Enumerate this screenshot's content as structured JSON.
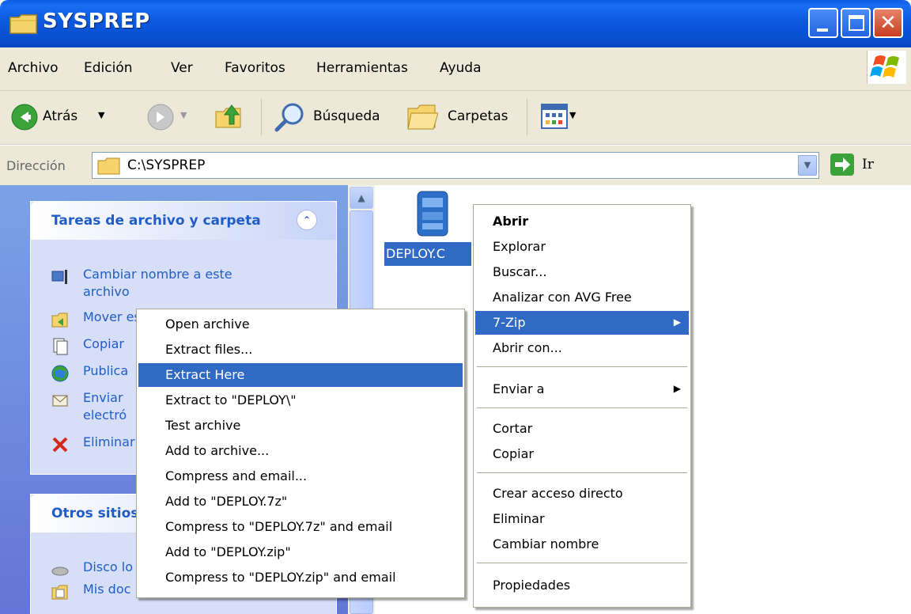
{
  "window": {
    "title": "SYSPREP"
  },
  "menubar": {
    "items": [
      "Archivo",
      "Edición",
      "Ver",
      "Favoritos",
      "Herramientas",
      "Ayuda"
    ]
  },
  "toolbar": {
    "back_label": "Atrás",
    "search_label": "Búsqueda",
    "folders_label": "Carpetas"
  },
  "address": {
    "label": "Dirección",
    "value": "C:\\SYSPREP",
    "go_label": "Ir"
  },
  "tasks": {
    "panel_title": "Tareas de archivo y carpeta",
    "items": [
      "Cambiar nombre a este",
      "archivo",
      "Mover este archivo",
      "Copiar",
      "Publica",
      "Enviar",
      "electró",
      "Eliminar"
    ]
  },
  "other_places": {
    "panel_title": "Otros sitios",
    "items": [
      "Disco lo",
      "Mis doc"
    ]
  },
  "file": {
    "name": "DEPLOY.C"
  },
  "context_menu": {
    "items": [
      "Abrir",
      "Explorar",
      "Buscar...",
      "Analizar con AVG Free",
      "7-Zip",
      "Abrir con...",
      "Enviar a",
      "Cortar",
      "Copiar",
      "Crear acceso directo",
      "Eliminar",
      "Cambiar nombre",
      "Propiedades"
    ]
  },
  "submenu_7zip": {
    "items": [
      "Open archive",
      "Extract files...",
      "Extract Here",
      "Extract to \"DEPLOY\\\"",
      "Test archive",
      "Add to archive...",
      "Compress and email...",
      "Add to \"DEPLOY.7z\"",
      "Compress to \"DEPLOY.7z\" and email",
      "Add to \"DEPLOY.zip\"",
      "Compress to \"DEPLOY.zip\" and email"
    ],
    "highlighted": "Extract Here"
  },
  "colors": {
    "titlebar": "#0a58dd",
    "chrome": "#ece9d8",
    "selection": "#316ac5",
    "task_link": "#215dc6",
    "pane_bg": "#6f8ddd"
  }
}
